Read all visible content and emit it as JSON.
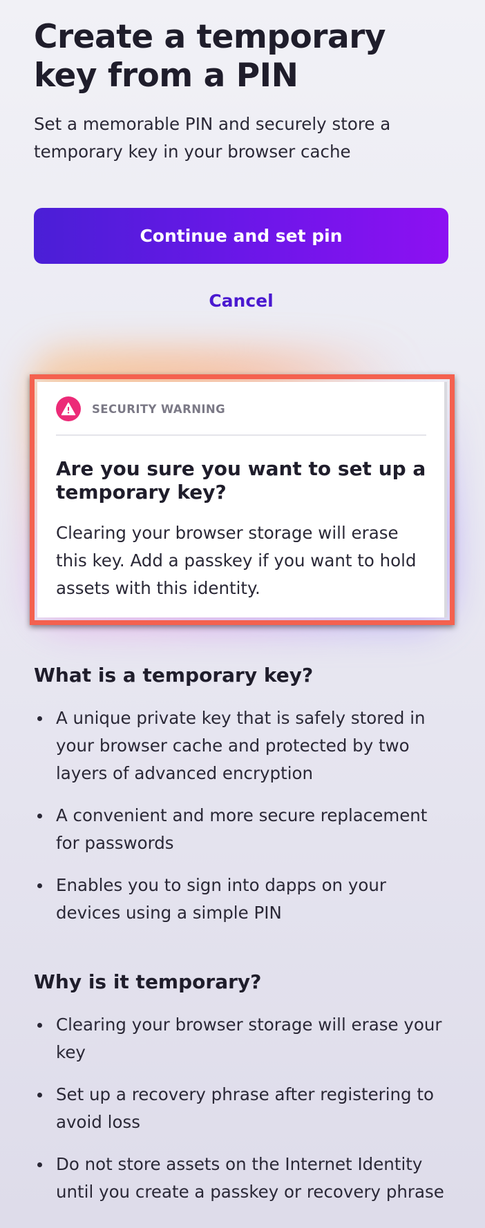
{
  "header": {
    "title": "Create a temporary key from a PIN",
    "subtitle": "Set a memorable PIN and securely store a temporary key in your browser cache"
  },
  "actions": {
    "continue_label": "Continue and set pin",
    "cancel_label": "Cancel"
  },
  "warning": {
    "icon": "warning-triangle-icon",
    "label": "SECURITY WARNING",
    "title": "Are you sure you want to set up a temporary key?",
    "body": "Clearing your browser storage will erase this key. Add a passkey if you want to hold assets with this identity."
  },
  "what_section": {
    "heading": "What is a temporary key?",
    "items": [
      "A unique private key that is safely stored in your browser cache and protected by two layers of advanced encryption",
      "A convenient and more secure replacement for passwords",
      "Enables you to sign into dapps on your devices using a simple PIN"
    ]
  },
  "why_section": {
    "heading": "Why is it temporary?",
    "items": [
      "Clearing your browser storage will erase your key",
      "Set up a recovery phrase after registering to avoid loss",
      "Do not store assets on the Internet Identity until you create a passkey or recovery phrase"
    ]
  },
  "colors": {
    "primary_start": "#4a1fd6",
    "primary_end": "#8d10f2",
    "link": "#4a19d0",
    "warning_icon": "#ec2a77",
    "highlight_outline": "#f4614f"
  }
}
